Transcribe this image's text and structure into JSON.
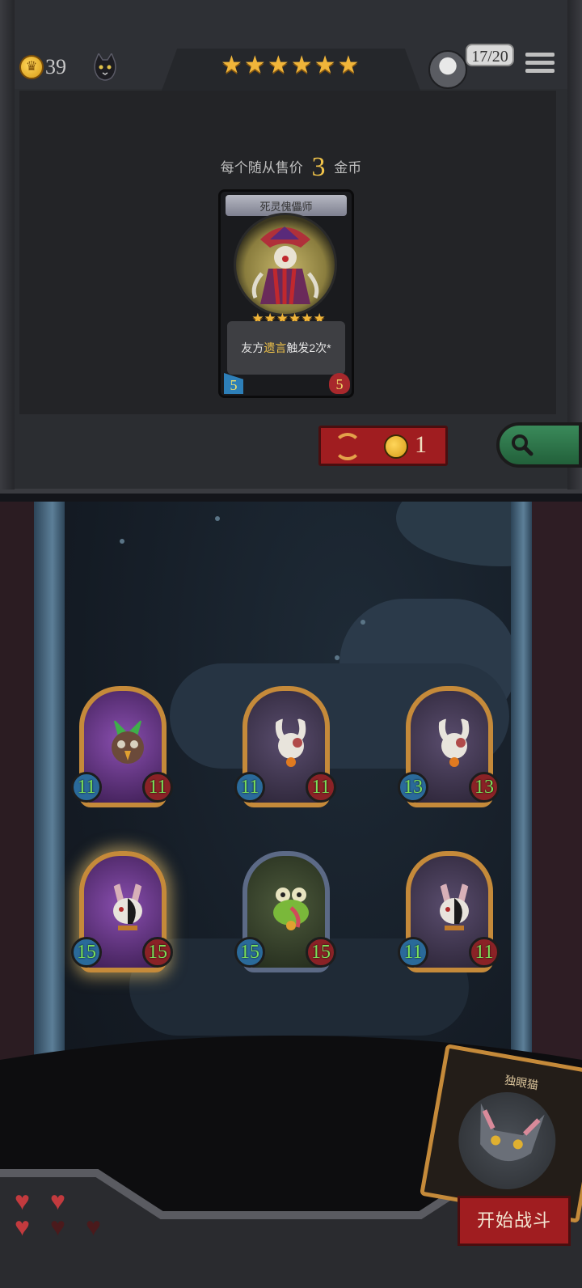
{
  "hud": {
    "gold": "39",
    "turn": "17/20",
    "tier_stars": 6
  },
  "shop": {
    "sell_prefix": "每个随从售价",
    "sell_price": "3",
    "sell_suffix": "金币",
    "minion": {
      "name": "死灵傀儡师",
      "stars": 6,
      "text_before": "友方",
      "text_highlight": "遗言",
      "text_after": "触发2次*",
      "attack": "5",
      "health": "5"
    },
    "refresh_cost": "1"
  },
  "board": {
    "minions": [
      {
        "attack": "11",
        "health": "11",
        "icon": "shaman-bird"
      },
      {
        "attack": "11",
        "health": "11",
        "icon": "voodoo-rabbit"
      },
      {
        "attack": "13",
        "health": "13",
        "icon": "voodoo-rabbit"
      },
      {
        "attack": "15",
        "health": "15",
        "icon": "masked-rabbit"
      },
      {
        "attack": "15",
        "health": "15",
        "icon": "frog"
      },
      {
        "attack": "11",
        "health": "11",
        "icon": "masked-rabbit"
      }
    ]
  },
  "player": {
    "lives_total": 5,
    "lives_remaining": 3
  },
  "hand_card": {
    "name": "独眼猫"
  },
  "start_button": "开始战斗",
  "colors": {
    "gold": "#f0c34a",
    "red_button": "#a01d20",
    "card_frame": "#c58a3a",
    "stat_green": "#7be05a"
  }
}
